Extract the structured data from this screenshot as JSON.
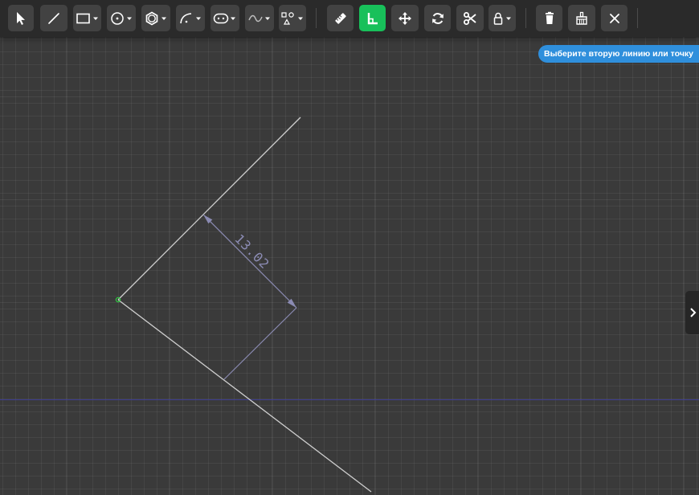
{
  "toolbar": {
    "tools": [
      {
        "name": "select-tool",
        "icon": "cursor-arrow-icon"
      },
      {
        "name": "line-tool",
        "icon": "line-icon"
      },
      {
        "name": "rectangle-tool",
        "icon": "rectangle-icon",
        "dropdown": true
      },
      {
        "name": "circle-tool",
        "icon": "circle-icon",
        "dropdown": true
      },
      {
        "name": "polygon-tool",
        "icon": "hexagon-icon",
        "dropdown": true
      },
      {
        "name": "arc-tool",
        "icon": "arc-icon",
        "dropdown": true
      },
      {
        "name": "slot-tool",
        "icon": "slot-icon",
        "dropdown": true
      },
      {
        "name": "spline-tool",
        "icon": "spline-icon",
        "dropdown": true
      },
      {
        "name": "shapes-tool",
        "icon": "shapes-icon",
        "dropdown": true
      },
      {
        "name": "dimension-tool",
        "icon": "ruler-icon"
      },
      {
        "name": "angle-tool",
        "icon": "corner-icon",
        "active": true
      },
      {
        "name": "move-tool",
        "icon": "move-icon"
      },
      {
        "name": "rotate-tool",
        "icon": "rotate-icon"
      },
      {
        "name": "trim-tool",
        "icon": "scissors-icon"
      },
      {
        "name": "constraint-tool",
        "icon": "lock-icon",
        "dropdown": true
      },
      {
        "name": "delete-button",
        "icon": "trash-icon"
      },
      {
        "name": "clear-button",
        "icon": "broom-icon"
      },
      {
        "name": "close-button",
        "icon": "close-icon"
      }
    ]
  },
  "hint": {
    "text": "Выберите вторую линию или точку"
  },
  "sketch": {
    "dimension_value": "13.02"
  },
  "colors": {
    "background": "#3a3a3a",
    "toolbar": "#2a2a2a",
    "button": "#424242",
    "active_button": "#18c05a",
    "hint_bg": "#2f8fdc",
    "geometry_line": "#cfcfcf",
    "dimension": "#8b8bb3",
    "origin_point": "#2ecc40",
    "axis": "#3b3b8f"
  },
  "side_panel": {
    "toggle_icon": "chevron-right-icon"
  }
}
